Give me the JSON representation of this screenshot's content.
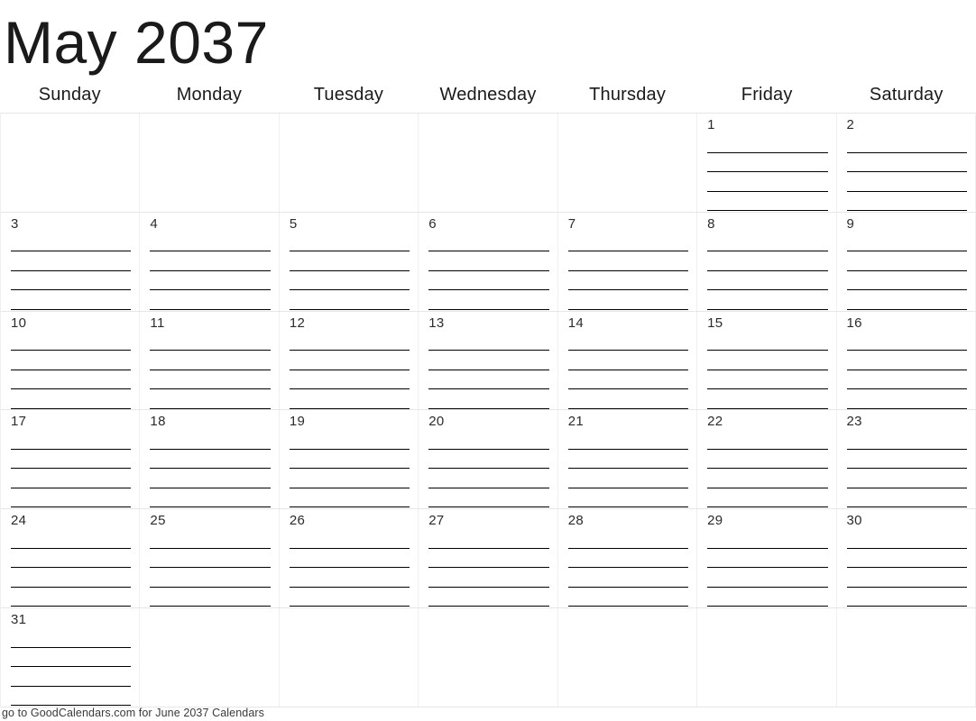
{
  "title": "May 2037",
  "weekdays": [
    "Sunday",
    "Monday",
    "Tuesday",
    "Wednesday",
    "Thursday",
    "Friday",
    "Saturday"
  ],
  "lines_per_day": 4,
  "colors": {
    "text": "#1a1a1a",
    "day_number": "#2b2b2b",
    "grid_line": "#e6e6e6",
    "column_line": "#efefef",
    "write_line": "#000000",
    "background": "#ffffff",
    "footer_text": "#3a3a3a"
  },
  "weeks": [
    [
      {
        "day": "",
        "filled": false
      },
      {
        "day": "",
        "filled": false
      },
      {
        "day": "",
        "filled": false
      },
      {
        "day": "",
        "filled": false
      },
      {
        "day": "",
        "filled": false
      },
      {
        "day": "1",
        "filled": true
      },
      {
        "day": "2",
        "filled": true
      }
    ],
    [
      {
        "day": "3",
        "filled": true
      },
      {
        "day": "4",
        "filled": true
      },
      {
        "day": "5",
        "filled": true
      },
      {
        "day": "6",
        "filled": true
      },
      {
        "day": "7",
        "filled": true
      },
      {
        "day": "8",
        "filled": true
      },
      {
        "day": "9",
        "filled": true
      }
    ],
    [
      {
        "day": "10",
        "filled": true
      },
      {
        "day": "11",
        "filled": true
      },
      {
        "day": "12",
        "filled": true
      },
      {
        "day": "13",
        "filled": true
      },
      {
        "day": "14",
        "filled": true
      },
      {
        "day": "15",
        "filled": true
      },
      {
        "day": "16",
        "filled": true
      }
    ],
    [
      {
        "day": "17",
        "filled": true
      },
      {
        "day": "18",
        "filled": true
      },
      {
        "day": "19",
        "filled": true
      },
      {
        "day": "20",
        "filled": true
      },
      {
        "day": "21",
        "filled": true
      },
      {
        "day": "22",
        "filled": true
      },
      {
        "day": "23",
        "filled": true
      }
    ],
    [
      {
        "day": "24",
        "filled": true
      },
      {
        "day": "25",
        "filled": true
      },
      {
        "day": "26",
        "filled": true
      },
      {
        "day": "27",
        "filled": true
      },
      {
        "day": "28",
        "filled": true
      },
      {
        "day": "29",
        "filled": true
      },
      {
        "day": "30",
        "filled": true
      }
    ],
    [
      {
        "day": "31",
        "filled": true
      },
      {
        "day": "",
        "filled": false
      },
      {
        "day": "",
        "filled": false
      },
      {
        "day": "",
        "filled": false
      },
      {
        "day": "",
        "filled": false
      },
      {
        "day": "",
        "filled": false
      },
      {
        "day": "",
        "filled": false
      }
    ]
  ],
  "footer": "go to GoodCalendars.com for June 2037 Calendars"
}
